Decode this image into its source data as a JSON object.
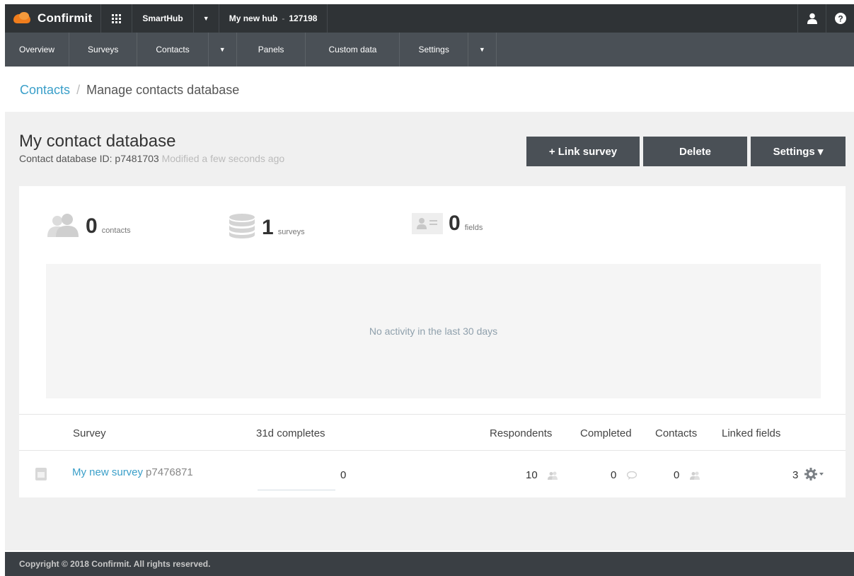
{
  "topbar": {
    "brand": "Confirmit",
    "app_name": "SmartHub",
    "hub_name": "My new hub",
    "hub_id": "127198"
  },
  "nav": {
    "items": [
      "Overview",
      "Surveys",
      "Contacts",
      "Panels",
      "Custom data",
      "Settings"
    ]
  },
  "breadcrumb": {
    "parent": "Contacts",
    "separator": "/",
    "current": "Manage contacts database"
  },
  "database": {
    "title": "My contact database",
    "id_label": "Contact database ID:",
    "id": "p7481703",
    "modified": "Modified a few seconds ago"
  },
  "actions": {
    "link_survey": "+ Link survey",
    "delete": "Delete",
    "settings": "Settings ▾"
  },
  "stats": {
    "contacts": {
      "value": "0",
      "label": "contacts"
    },
    "surveys": {
      "value": "1",
      "label": "surveys"
    },
    "fields": {
      "value": "0",
      "label": "fields"
    }
  },
  "activity": {
    "empty_message": "No activity in the last 30 days"
  },
  "table": {
    "headers": {
      "survey": "Survey",
      "completes": "31d completes",
      "respondents": "Respondents",
      "completed": "Completed",
      "contacts": "Contacts",
      "linked_fields": "Linked fields"
    },
    "rows": [
      {
        "name": "My new survey",
        "id": "p7476871",
        "completes_31d": "0",
        "respondents": "10",
        "completed": "0",
        "contacts": "0",
        "linked_fields": "3"
      }
    ]
  },
  "footer": {
    "copyright": "Copyright © 2018 Confirmit. All rights reserved."
  },
  "colors": {
    "topbar": "#2f3336",
    "navbar": "#4a5056",
    "link": "#3a9fc9",
    "accent": "#f07d1c"
  }
}
